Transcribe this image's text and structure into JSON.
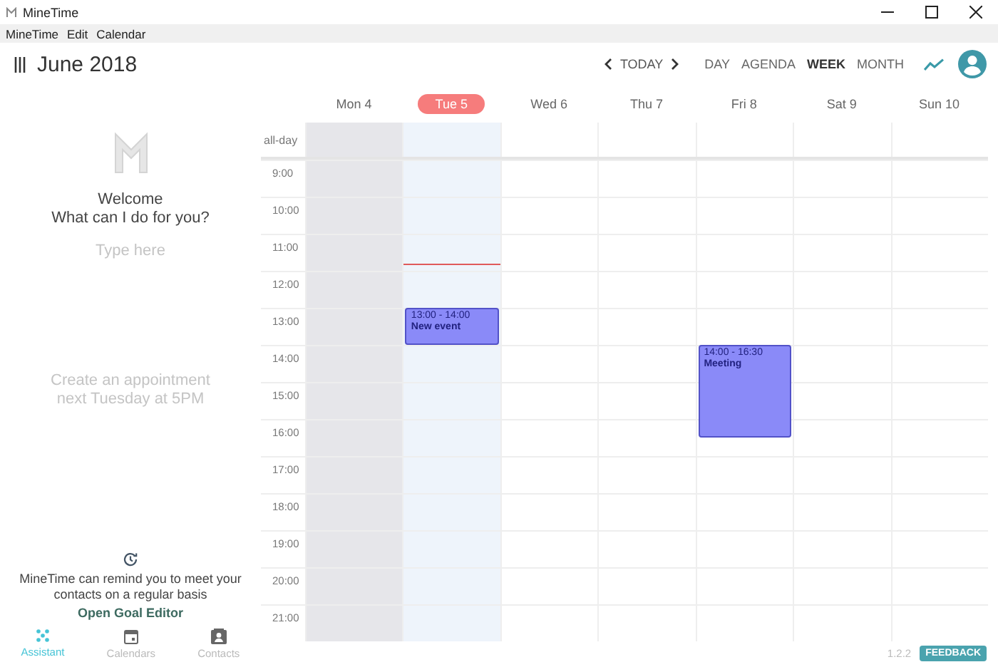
{
  "window": {
    "title": "MineTime"
  },
  "menu": [
    "MineTime",
    "Edit",
    "Calendar"
  ],
  "header": {
    "month": "June 2018",
    "today": "TODAY",
    "views": [
      {
        "label": "DAY",
        "selected": false
      },
      {
        "label": "AGENDA",
        "selected": false
      },
      {
        "label": "WEEK",
        "selected": true
      },
      {
        "label": "MONTH",
        "selected": false
      }
    ]
  },
  "assistant": {
    "greeting": "Welcome",
    "question": "What can I do for you?",
    "input": {
      "placeholder": "Type here"
    },
    "suggestion": "Create an appointment next Tuesday at 5PM",
    "reminder": "MineTime can remind you to meet your contacts on a regular basis",
    "link": "Open Goal Editor"
  },
  "bottom_nav": [
    {
      "kind": "assistant",
      "label": "Assistant",
      "selected": true
    },
    {
      "kind": "calendars",
      "label": "Calendars",
      "selected": false
    },
    {
      "kind": "contacts",
      "label": "Contacts",
      "selected": false
    }
  ],
  "week": {
    "all_day_label": "all-day",
    "hours": [
      "9:00",
      "10:00",
      "11:00",
      "12:00",
      "13:00",
      "14:00",
      "15:00",
      "16:00",
      "17:00",
      "18:00",
      "19:00",
      "20:00",
      "21:00"
    ],
    "days": [
      {
        "label": "Mon 4",
        "selected": false,
        "past": true
      },
      {
        "label": "Tue 5",
        "selected": true,
        "past": false,
        "events": [
          {
            "time": "13:00 - 14:00",
            "title": "New event"
          }
        ]
      },
      {
        "label": "Wed 6",
        "selected": false,
        "past": false
      },
      {
        "label": "Thu 7",
        "selected": false,
        "past": false
      },
      {
        "label": "Fri 8",
        "selected": false,
        "past": false,
        "events": [
          {
            "time": "14:00 - 16:30",
            "title": "Meeting"
          }
        ]
      },
      {
        "label": "Sat 9",
        "selected": false,
        "past": false
      },
      {
        "label": "Sun 10",
        "selected": false,
        "past": false
      }
    ]
  },
  "footer": {
    "version": "1.2.2",
    "feedback": "FEEDBACK"
  }
}
